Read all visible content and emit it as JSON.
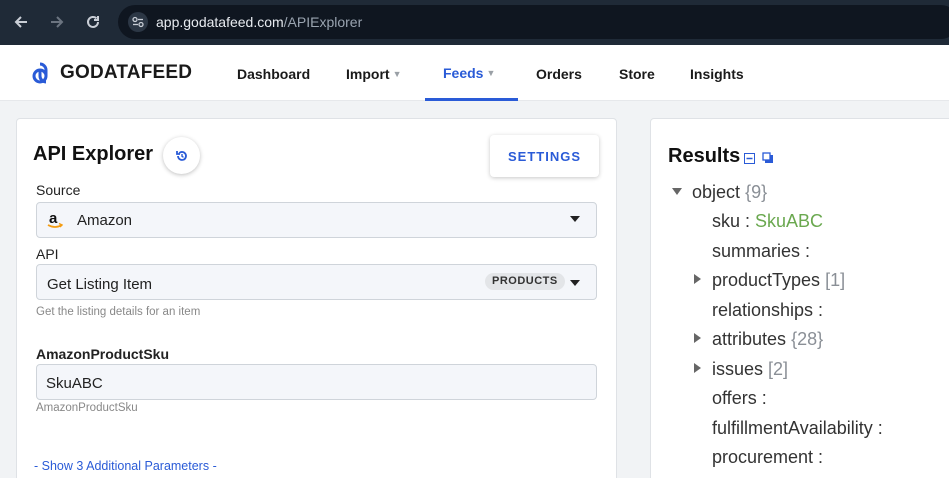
{
  "browser": {
    "url_host": "app.godatafeed.com",
    "url_path": "/APIExplorer"
  },
  "header": {
    "logo_text": "GODATAFEED",
    "nav": {
      "dashboard": "Dashboard",
      "import": "Import",
      "feeds": "Feeds",
      "orders": "Orders",
      "store": "Store",
      "insights": "Insights"
    },
    "active_item": "Feeds",
    "accent_color": "#2a5bd7"
  },
  "explorer": {
    "title": "API Explorer",
    "settings_label": "SETTINGS",
    "source_label": "Source",
    "source_value": "Amazon",
    "api_label": "API",
    "api_value": "Get Listing Item",
    "api_badge": "PRODUCTS",
    "api_help": "Get the listing details for an item",
    "sku_label": "AmazonProductSku",
    "sku_value": "SkuABC",
    "sku_help": "AmazonProductSku",
    "additional_params_link": "- Show 3 Additional Parameters -"
  },
  "results": {
    "title": "Results",
    "root_key": "object",
    "root_count": "{9}",
    "items": {
      "sku_key": "sku :",
      "sku_value": "SkuABC",
      "summaries": "summaries :",
      "productTypes": "productTypes",
      "productTypes_count": "[1]",
      "relationships": "relationships :",
      "attributes": "attributes",
      "attributes_count": "{28}",
      "issues": "issues",
      "issues_count": "[2]",
      "offers": "offers :",
      "fulfillmentAvailability": "fulfillmentAvailability :",
      "procurement": "procurement :"
    }
  }
}
